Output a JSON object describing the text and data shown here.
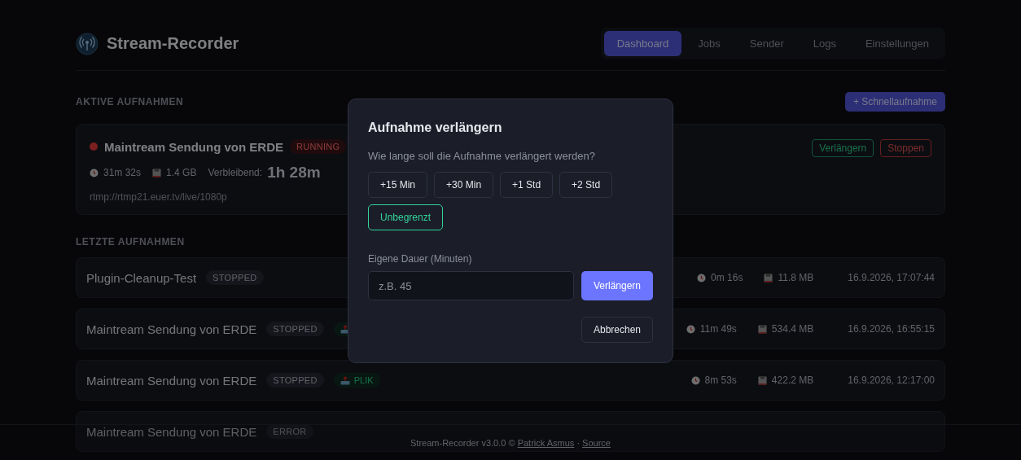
{
  "app": {
    "title": "Stream-Recorder"
  },
  "nav": [
    {
      "label": "Dashboard",
      "selected": true
    },
    {
      "label": "Jobs",
      "selected": false
    },
    {
      "label": "Sender",
      "selected": false
    },
    {
      "label": "Logs",
      "selected": false
    },
    {
      "label": "Einstellungen",
      "selected": false
    }
  ],
  "active": {
    "title": "AKTIVE AUFNAHMEN",
    "quick_button": "+ Schnellaufnahme",
    "recording": {
      "name": "Maintream Sendung von ERDE",
      "status": "RUNNING",
      "duration": "31m 32s",
      "size": "1.4 GB",
      "remaining_label": "Verbleibend:",
      "remaining": "1h 28m",
      "url": "rtmp://rtmp21.euer.tv/live/1080p",
      "actions": [
        {
          "label": "Verlängern",
          "kind": "extend"
        },
        {
          "label": "Stoppen",
          "kind": "stop"
        }
      ]
    }
  },
  "recent": {
    "title": "LETZTE AUFNAHMEN",
    "rows": [
      {
        "name": "Plugin-Cleanup-Test",
        "status": "STOPPED",
        "has_tag": false,
        "duration": "0m 16s",
        "size": "11.8 MB",
        "date": "16.9.2026, 17:07:44"
      },
      {
        "name": "Maintream Sendung von ERDE",
        "status": "STOPPED",
        "has_tag": true,
        "duration": "11m 49s",
        "size": "534.4 MB",
        "date": "16.9.2026, 16:55:15"
      },
      {
        "name": "Maintream Sendung von ERDE",
        "status": "STOPPED",
        "has_tag": true,
        "tag": "PLIK",
        "duration": "8m 53s",
        "size": "422.2 MB",
        "date": "16.9.2026, 12:17:00"
      },
      {
        "name": "Maintream Sendung von ERDE",
        "status": "ERROR",
        "has_tag": false
      }
    ]
  },
  "footer": {
    "text": "Stream-Recorder v3.0.0 ©",
    "author": "Patrick Asmus",
    "separator": "·",
    "source": "Source"
  },
  "dialog": {
    "title": "Aufnahme verlängern",
    "question": "Wie lange soll die Aufnahme verlängert werden?",
    "choices": [
      {
        "label": "+15 Min",
        "kind": "preset"
      },
      {
        "label": "+30 Min",
        "kind": "preset"
      },
      {
        "label": "+1 Std",
        "kind": "preset"
      },
      {
        "label": "+2 Std",
        "kind": "preset"
      },
      {
        "label": "Unbegrenzt",
        "kind": "unlimited"
      }
    ],
    "custom_label": "Eigene Dauer (Minuten)",
    "custom_placeholder": "z.B. 45",
    "submit": "Verlängern",
    "cancel": "Abbrechen"
  }
}
